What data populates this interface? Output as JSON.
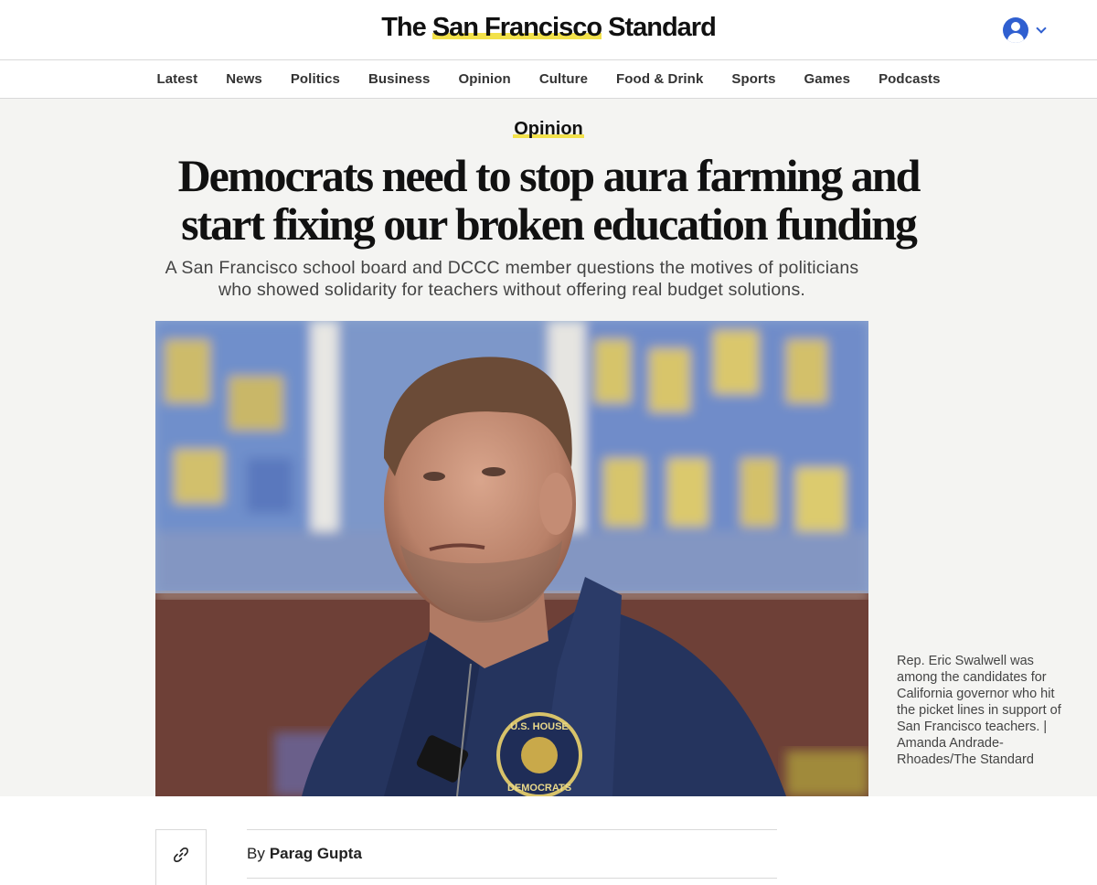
{
  "header": {
    "logo_pre": "The ",
    "logo_highlight": "San Francisco",
    "logo_post": " Standard",
    "account_icon": "user-avatar-icon",
    "account_menu_icon": "chevron-down-icon",
    "accent_color": "#f2e14a",
    "avatar_color": "#2f5fd0"
  },
  "nav": {
    "items": [
      "Latest",
      "News",
      "Politics",
      "Business",
      "Opinion",
      "Culture",
      "Food & Drink",
      "Sports",
      "Games",
      "Podcasts"
    ]
  },
  "article": {
    "section": "Opinion",
    "headline": "Democrats need to stop aura farming and start fixing our broken education funding",
    "dek": "A San Francisco school board and DCCC member questions the motives of politicians who showed solidarity for teachers without offering real budget solutions.",
    "photo_caption": "Rep. Eric Swalwell was among the candidates for California governor who hit the picket lines in support of San Francisco teachers. | Amanda Andrade-Rhoades/The Standard",
    "photo_badge_top": "U.S. HOUSE",
    "photo_badge_bottom": "DEMOCRATS",
    "byline_prefix": "By",
    "author": "Parag Gupta",
    "share_icon": "link-icon"
  }
}
